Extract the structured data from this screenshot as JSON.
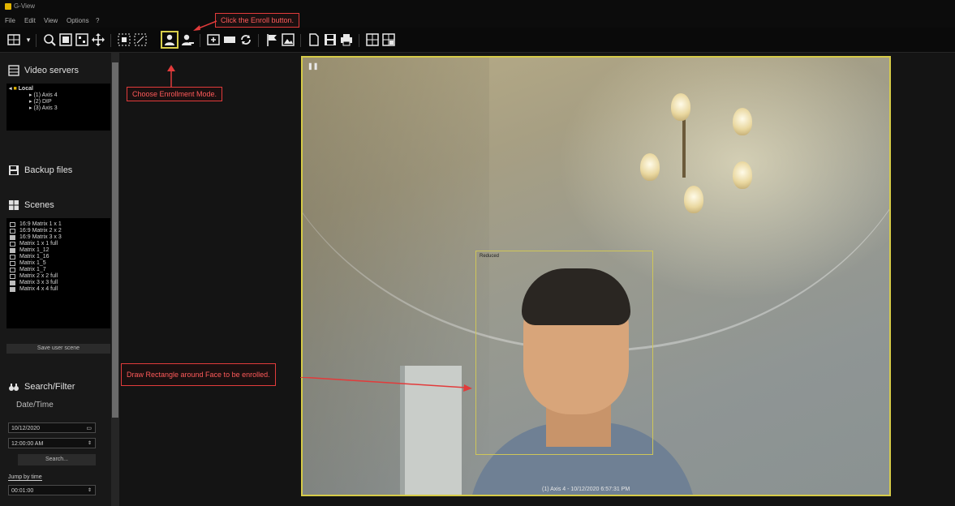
{
  "app": {
    "title": "G-View"
  },
  "menu": {
    "file": "File",
    "edit": "Edit",
    "view": "View",
    "options": "Options",
    "help": "?"
  },
  "callouts": {
    "enroll_button": "Click the Enroll button.",
    "enrollment_mode": "Choose Enrollment Mode.",
    "draw_rectangle": "Draw Rectangle around Face to be enrolled."
  },
  "sidebar": {
    "video_servers": {
      "title": "Video servers",
      "root": "Local",
      "cameras": [
        "(1) Axis 4",
        "(2) DIP",
        "(3) Axis 3"
      ]
    },
    "backup_title": "Backup files",
    "scenes": {
      "title": "Scenes",
      "items": [
        "16:9 Matrix 1 x 1",
        "16:9 Matrix 2 x 2",
        "16:9 Matrix 3 x 3",
        "Matrix 1 x 1 full",
        "Matrix 1_12",
        "Matrix 1_16",
        "Matrix 1_5",
        "Matrix 1_7",
        "Matrix 2 x 2 full",
        "Matrix 3 x 3 full",
        "Matrix 4 x 4 full"
      ]
    },
    "save_user_scene": "Save user scene",
    "search": {
      "title": "Search/Filter",
      "date_time_label": "Date/Time",
      "date_value": "10/12/2020",
      "time_value": "12:00:00 AM",
      "search_button": "Search...",
      "jump_label": "Jump by time",
      "jump_value": "00:01:00"
    }
  },
  "video": {
    "face_label": "Reduced",
    "overlay_timestamp": "(1) Axis 4 - 10/12/2020 6:57:31 PM"
  }
}
